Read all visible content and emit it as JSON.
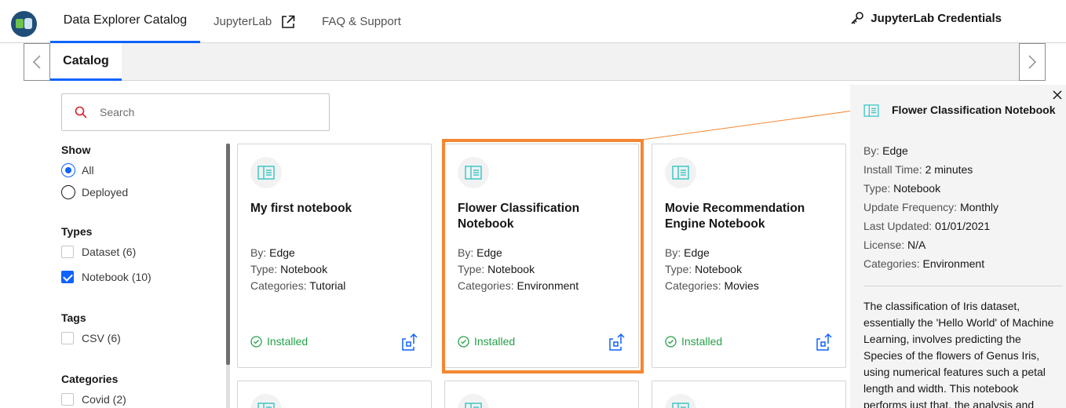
{
  "nav": {
    "tabs": [
      {
        "label": "Data Explorer Catalog"
      },
      {
        "label": "JupyterLab"
      },
      {
        "label": "FAQ & Support"
      }
    ],
    "credentials_label": "JupyterLab Credentials"
  },
  "subnav": {
    "tab_label": "Catalog"
  },
  "search": {
    "placeholder": "Search"
  },
  "filters": {
    "show": {
      "heading": "Show",
      "options": [
        "All",
        "Deployed"
      ],
      "selected": "All"
    },
    "types": {
      "heading": "Types",
      "options": [
        {
          "label": "Dataset (6)",
          "checked": false
        },
        {
          "label": "Notebook (10)",
          "checked": true
        }
      ]
    },
    "tags": {
      "heading": "Tags",
      "options": [
        {
          "label": "CSV (6)",
          "checked": false
        }
      ]
    },
    "categories": {
      "heading": "Categories",
      "options": [
        {
          "label": "Covid (2)",
          "checked": false
        }
      ]
    }
  },
  "labels": {
    "by": "By:",
    "type": "Type:",
    "categories": "Categories:",
    "install_time": "Install Time:",
    "update_frequency": "Update Frequency:",
    "last_updated": "Last Updated:",
    "license": "License:"
  },
  "cards": [
    {
      "title": "My first notebook",
      "by": "Edge",
      "type": "Notebook",
      "categories": "Tutorial",
      "status": "Installed"
    },
    {
      "title": "Flower Classification Notebook",
      "by": "Edge",
      "type": "Notebook",
      "categories": "Environment",
      "status": "Installed"
    },
    {
      "title": "Movie Recommendation Engine Notebook",
      "by": "Edge",
      "type": "Notebook",
      "categories": "Movies",
      "status": "Installed"
    }
  ],
  "detail": {
    "title": "Flower Classification Notebook",
    "by": "Edge",
    "install_time": "2 minutes",
    "type": "Notebook",
    "update_frequency": "Monthly",
    "last_updated": "01/01/2021",
    "license": "N/A",
    "categories": "Environment",
    "description": "The classification of Iris dataset, essentially the 'Hello World' of Machine Learning, involves predicting the Species of the flowers of Genus Iris, using numerical features such a petal length and width. This notebook performs just that, the analysis and"
  },
  "colors": {
    "accent": "#0f62fe",
    "highlight": "#f58632",
    "installed": "#24a148",
    "notebook_icon": "#3ec8c8"
  }
}
